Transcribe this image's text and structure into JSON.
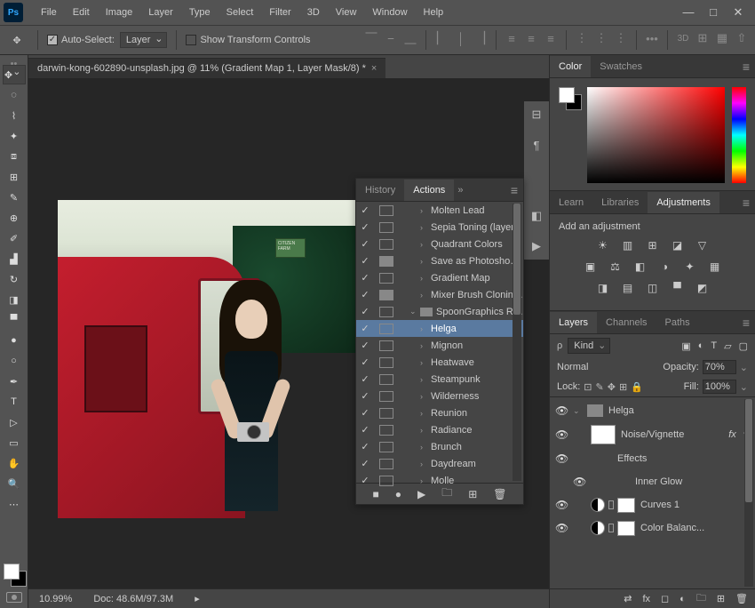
{
  "menubar": [
    "File",
    "Edit",
    "Image",
    "Layer",
    "Type",
    "Select",
    "Filter",
    "3D",
    "View",
    "Window",
    "Help"
  ],
  "window_controls": {
    "min": "—",
    "max": "□",
    "close": "✕"
  },
  "options": {
    "auto_select_label": "Auto-Select:",
    "auto_select_value": "Layer",
    "show_transform_label": "Show Transform Controls",
    "threeD": "3D"
  },
  "document": {
    "tab_title": "darwin-kong-602890-unsplash.jpg @ 11% (Gradient Map 1, Layer Mask/8) *",
    "zoom": "10.99%",
    "doc_info": "Doc: 48.6M/97.3M",
    "sign_text": "CITIZEN FARM"
  },
  "history_panel": {
    "history_tab": "History",
    "actions_tab": "Actions"
  },
  "actions": [
    {
      "name": "Molten Lead",
      "check": true,
      "twist": ">",
      "indent": 2
    },
    {
      "name": "Sepia Toning (layer)",
      "check": true,
      "twist": ">",
      "indent": 2
    },
    {
      "name": "Quadrant Colors",
      "check": true,
      "twist": ">",
      "indent": 2
    },
    {
      "name": "Save as Photoshop ...",
      "check": true,
      "sq": true,
      "twist": ">",
      "indent": 2
    },
    {
      "name": "Gradient Map",
      "check": true,
      "twist": ">",
      "indent": 2
    },
    {
      "name": "Mixer Brush Cloning...",
      "check": true,
      "sq": true,
      "twist": ">",
      "indent": 2
    },
    {
      "name": "SpoonGraphics Retr...",
      "check": true,
      "twist": "v",
      "folder": true,
      "indent": 1
    },
    {
      "name": "Helga",
      "check": true,
      "twist": ">",
      "indent": 2,
      "hl": true
    },
    {
      "name": "Mignon",
      "check": true,
      "twist": ">",
      "indent": 2
    },
    {
      "name": "Heatwave",
      "check": true,
      "twist": ">",
      "indent": 2
    },
    {
      "name": "Steampunk",
      "check": true,
      "twist": ">",
      "indent": 2
    },
    {
      "name": "Wilderness",
      "check": true,
      "twist": ">",
      "indent": 2
    },
    {
      "name": "Reunion",
      "check": true,
      "twist": ">",
      "indent": 2
    },
    {
      "name": "Radiance",
      "check": true,
      "twist": ">",
      "indent": 2
    },
    {
      "name": "Brunch",
      "check": true,
      "twist": ">",
      "indent": 2
    },
    {
      "name": "Daydream",
      "check": true,
      "twist": ">",
      "indent": 2
    },
    {
      "name": "Molle",
      "check": true,
      "twist": ">",
      "indent": 2
    }
  ],
  "color_panel": {
    "color_tab": "Color",
    "swatches_tab": "Swatches"
  },
  "learn_panel": {
    "learn": "Learn",
    "libraries": "Libraries",
    "adjustments": "Adjustments",
    "add_label": "Add an adjustment"
  },
  "layers_panel": {
    "layers": "Layers",
    "channels": "Channels",
    "paths": "Paths",
    "kind": "Kind",
    "blend": "Normal",
    "opacity_label": "Opacity:",
    "opacity": "70%",
    "lock_label": "Lock:",
    "fill_label": "Fill:",
    "fill": "100%",
    "items": [
      {
        "type": "group",
        "name": "Helga"
      },
      {
        "type": "layer",
        "name": "Noise/Vignette",
        "fx": true
      },
      {
        "type": "effects",
        "name": "Effects"
      },
      {
        "type": "effect",
        "name": "Inner Glow"
      },
      {
        "type": "adj",
        "name": "Curves 1"
      },
      {
        "type": "adj",
        "name": "Color Balanc..."
      }
    ]
  }
}
